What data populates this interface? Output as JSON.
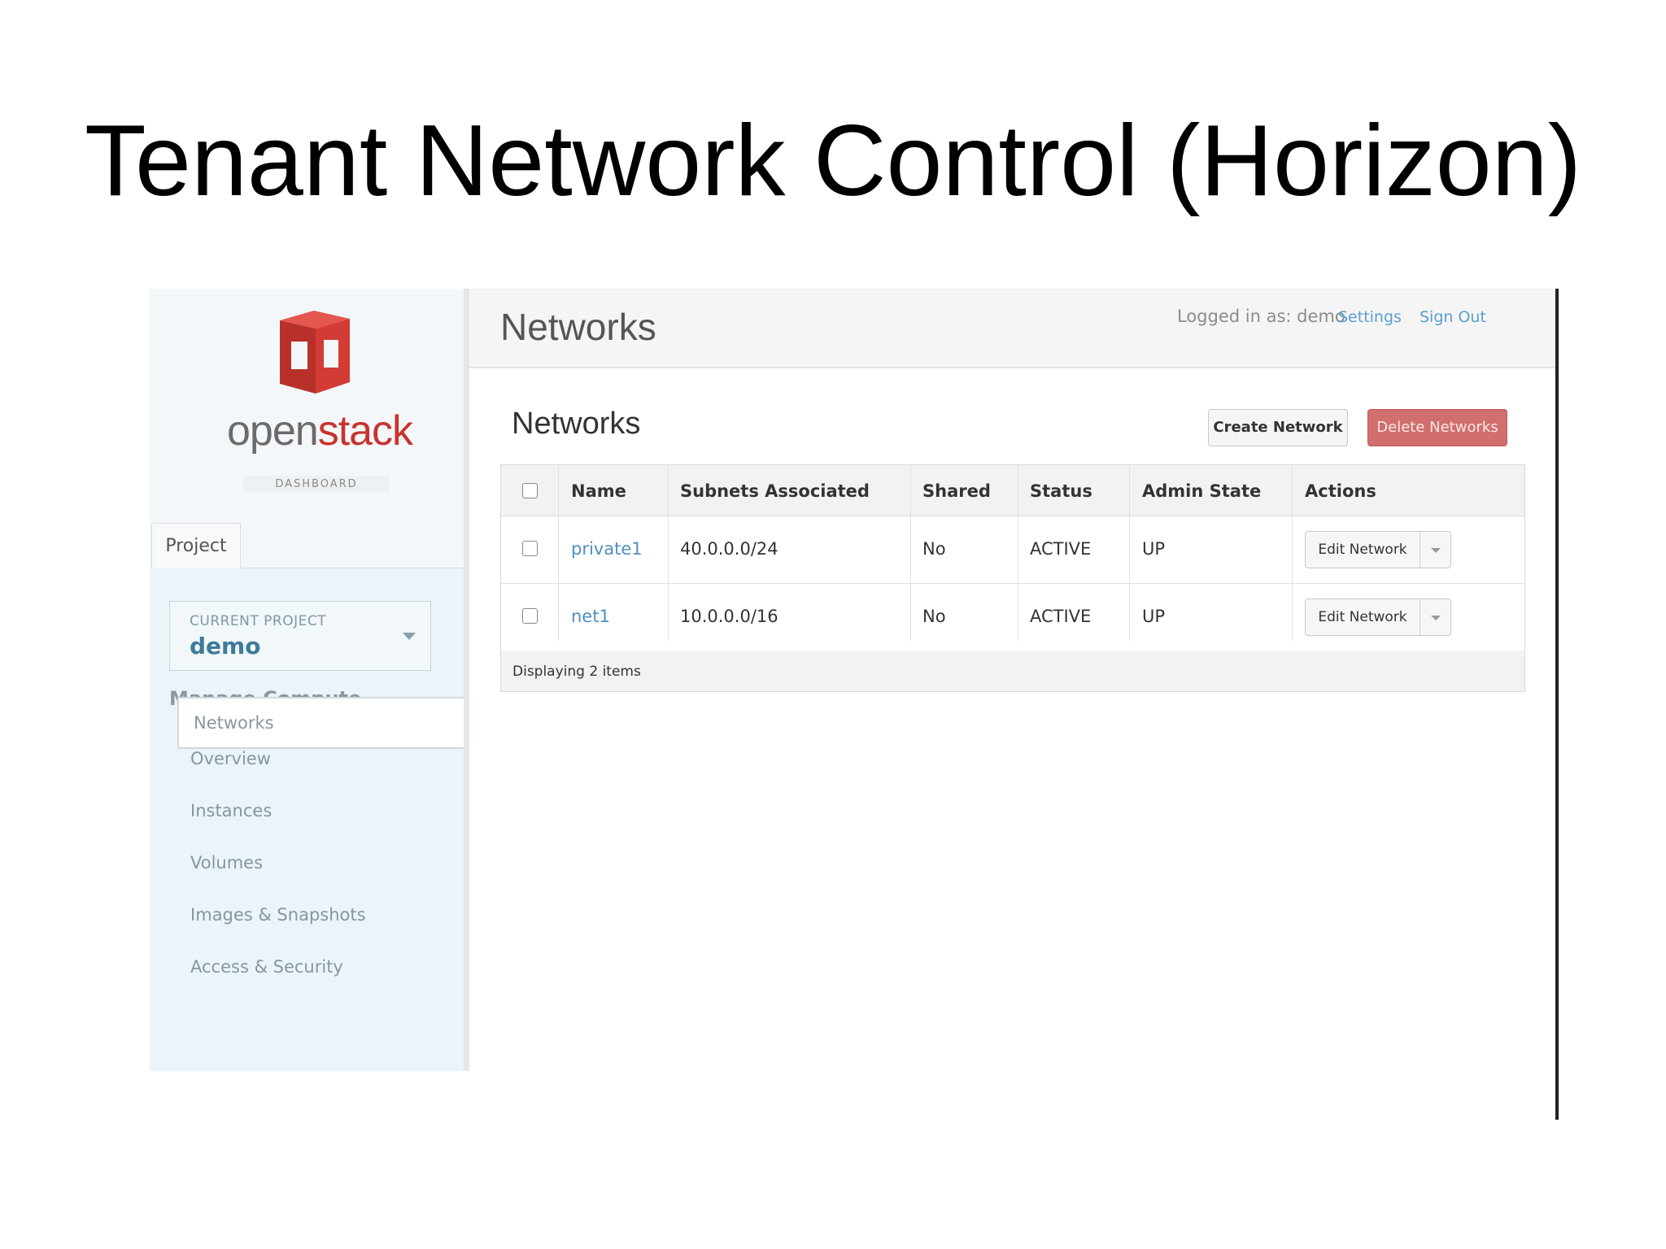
{
  "slide": {
    "title": "Tenant Network Control (Horizon)"
  },
  "brand": {
    "open": "open",
    "stack": "stack",
    "sub": "DASHBOARD",
    "accent": "#c8332d"
  },
  "sidebar": {
    "tab_label": "Project",
    "current_project_label": "CURRENT PROJECT",
    "current_project_name": "demo",
    "section_heading": "Manage Compute",
    "items": [
      {
        "label": "Overview"
      },
      {
        "label": "Instances"
      },
      {
        "label": "Volumes"
      },
      {
        "label": "Images & Snapshots"
      },
      {
        "label": "Access & Security"
      },
      {
        "label": "Networks",
        "active": true
      }
    ]
  },
  "header": {
    "title": "Networks",
    "logged_in": "Logged in as: demo",
    "settings_link": "Settings",
    "signout_link": "Sign Out"
  },
  "content": {
    "heading": "Networks",
    "create_button": "Create Network",
    "delete_button": "Delete Networks"
  },
  "table": {
    "columns": [
      "Name",
      "Subnets Associated",
      "Shared",
      "Status",
      "Admin State",
      "Actions"
    ],
    "rows": [
      {
        "name": "private1",
        "subnets": "40.0.0.0/24",
        "shared": "No",
        "status": "ACTIVE",
        "admin_state": "UP",
        "action": "Edit Network"
      },
      {
        "name": "net1",
        "subnets": "10.0.0.0/16",
        "shared": "No",
        "status": "ACTIVE",
        "admin_state": "UP",
        "action": "Edit Network"
      }
    ],
    "footer": "Displaying 2 items"
  }
}
